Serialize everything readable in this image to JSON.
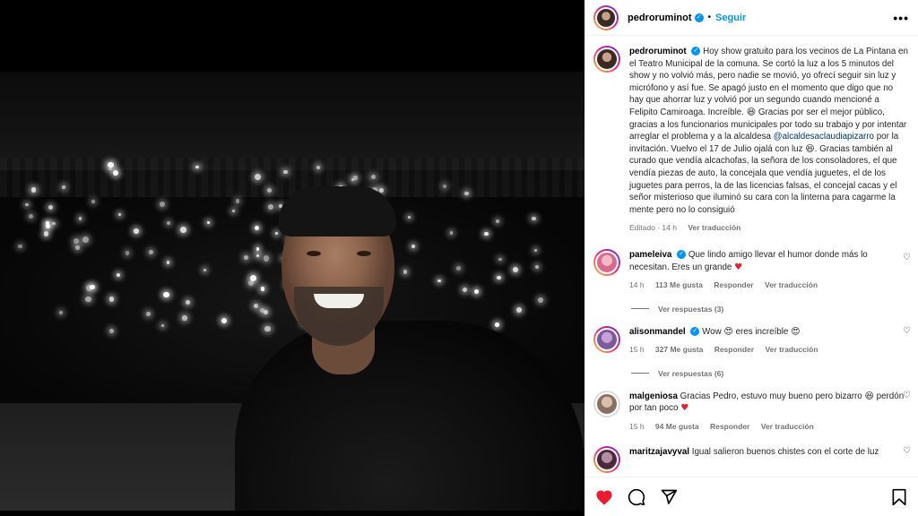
{
  "post": {
    "username": "pedroruminot",
    "separator": "•",
    "follow_label": "Seguir",
    "more_label": "•••",
    "caption_part1": "Hoy show gratuito para los vecinos de La Pintana en el Teatro Municipal de la comuna. Se cortó la luz a los 5 minutos del show y no volvió más, pero nadie se movió, yo ofrecí seguir sin luz y micrófono y así fue. Se apagó justo en el momento que digo que no hay que ahorrar luz y volvió por un segundo cuando mencioné a Felipito Camiroaga. Increíble. ",
    "caption_emoji1": "😆",
    "caption_part2": " Gracias por ser el mejor público, gracias a los funcionarios municipales por todo su trabajo y por intentar arreglar el problema y a la alcaldesa ",
    "caption_mention": "@alcaldesaclaudiapizarro",
    "caption_part3": " por la invitación. Vuelvo el 17 de Julio ojalá con luz ",
    "caption_emoji2": "😆",
    "caption_part4": ". Gracias también al curado que vendía alcachofas, la señora de los consoladores, el que vendía piezas de auto, la concejala que vendía juguetes, el de los juguetes para perros, la de las licencias falsas, el concejal cacas y el señor misterioso que iluminó su cara con la linterna para cagarme la mente pero no lo consiguió",
    "edited": "Editado · 14 h",
    "see_translation": "Ver traducción"
  },
  "comments": [
    {
      "username": "pameleiva",
      "text_before": "Que lindo amigo llevar el humor donde más lo necesitan. Eres un grande ",
      "emoji": "♥",
      "text_after": "",
      "time": "14 h",
      "likes": "113 Me gusta",
      "reply": "Responder",
      "translate": "Ver traducción",
      "replies": "Ver respuestas (3)"
    },
    {
      "username": "alisonmandel",
      "text_before": "Wow ",
      "emoji": "😍",
      "text_after": " eres increíble ",
      "emoji2": "😍",
      "time": "15 h",
      "likes": "327 Me gusta",
      "reply": "Responder",
      "translate": "Ver traducción",
      "replies": "Ver respuestas (6)"
    },
    {
      "username": "malgeniosa",
      "text_before": "Gracias Pedro, estuvo muy bueno pero bizarro ",
      "emoji": "😆",
      "text_after": " perdón por tan poco ",
      "emoji2": "♥",
      "time": "15 h",
      "likes": "94 Me gusta",
      "reply": "Responder",
      "translate": "Ver traducción"
    },
    {
      "username": "maritzajavyval",
      "text_before": "Igual salieron buenos chistes con el corte de luz"
    }
  ],
  "icons": {
    "like": "heart-icon",
    "comment": "comment-icon",
    "share": "share-icon",
    "save": "bookmark-icon",
    "comment_like": "heart-outline-icon"
  },
  "colors": {
    "accent": "#0095f6",
    "like_red": "#ed1b2f",
    "muted": "#737373"
  }
}
